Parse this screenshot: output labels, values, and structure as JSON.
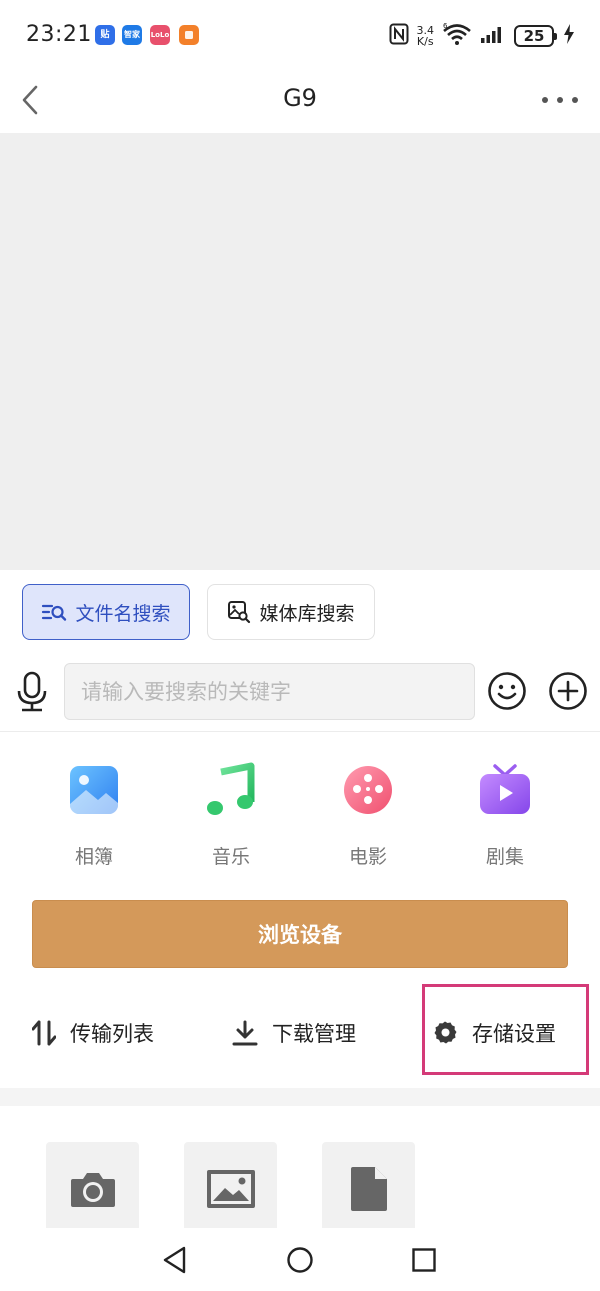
{
  "status_bar": {
    "time": "23:21",
    "badges": [
      "贴",
      "智家",
      "LoLo"
    ],
    "net_speed_value": "3.4",
    "net_speed_unit": "K/s",
    "battery": "25"
  },
  "header": {
    "title": "G9"
  },
  "search_tabs": [
    {
      "label": "文件名搜索",
      "icon": "file-search-icon",
      "active": true
    },
    {
      "label": "媒体库搜索",
      "icon": "image-search-icon",
      "active": false
    }
  ],
  "search": {
    "placeholder": "请输入要搜索的关键字",
    "value": ""
  },
  "categories": [
    {
      "label": "相簿",
      "icon": "album-icon",
      "color": "#4aa2f5"
    },
    {
      "label": "音乐",
      "icon": "music-icon",
      "color": "#3ccf74"
    },
    {
      "label": "电影",
      "icon": "movie-icon",
      "color": "#f56d87"
    },
    {
      "label": "剧集",
      "icon": "tv-series-icon",
      "color": "#9b5ef0"
    }
  ],
  "browse_button": "浏览设备",
  "actions": [
    {
      "label": "传输列表",
      "icon": "transfer-icon"
    },
    {
      "label": "下载管理",
      "icon": "download-icon"
    },
    {
      "label": "存储设置",
      "icon": "gear-icon",
      "highlighted": true
    }
  ],
  "tiles": [
    {
      "icon": "camera-icon"
    },
    {
      "icon": "image-icon"
    },
    {
      "icon": "document-icon"
    }
  ],
  "colors": {
    "accent_blue": "#2f4fbf",
    "browse_orange": "#d4995a",
    "highlight": "#d43a78"
  }
}
